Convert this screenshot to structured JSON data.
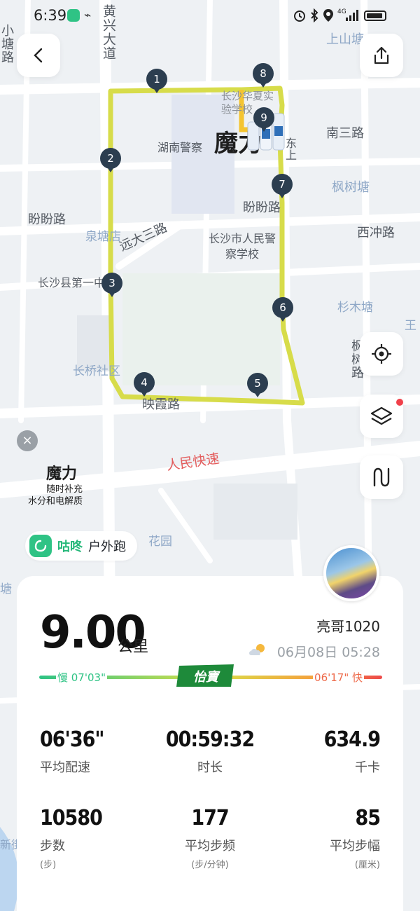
{
  "status_bar": {
    "time": "6:39",
    "network": "4G"
  },
  "map": {
    "labels": {
      "huangxing": "黄兴大道",
      "xiaotang": "小塘路",
      "shangshan": "上山塘",
      "nansan": "南三路",
      "hunan_police": "湖南警察",
      "fengshu": "枫树塘",
      "panpan_left": "盼盼路",
      "panpan_right": "盼盼路",
      "quantang": "泉塘店",
      "yuanda": "远大三路",
      "police_school": "长沙市人民警察学校",
      "xichong": "西冲路",
      "county_school": "长沙县第一中学",
      "shanmu": "杉木塘",
      "wang": "王",
      "fengshu_road": "枫树路",
      "changqiao": "长桥社区",
      "yingxia": "映霞路",
      "renmin": "人民快速",
      "huayuan": "花园",
      "tang": "塘",
      "xinjie": "新街",
      "shiyan": "长沙华夏实验学校",
      "dong": "东上"
    },
    "route_color": "#d7dc4a",
    "km_markers": [
      "1",
      "2",
      "3",
      "4",
      "5",
      "6",
      "7",
      "8",
      "9"
    ]
  },
  "ad": {
    "brand": "魔力",
    "line1": "随时补充",
    "line2": "水分和电解质",
    "close": "×"
  },
  "app": {
    "name": "咕咚",
    "mode": "户外跑",
    "accent": "#2fc385"
  },
  "activity": {
    "distance": "9.00",
    "distance_unit": "公里",
    "username": "亮哥1020",
    "datetime": "06月08日 05:28",
    "pace_slow": "慢 07'03\"",
    "pace_fast": "06'17\" 快",
    "sponsor": "怡寶"
  },
  "stats": {
    "avg_pace": {
      "value": "06'36\"",
      "label": "平均配速"
    },
    "duration": {
      "value": "00:59:32",
      "label": "时长"
    },
    "calories": {
      "value": "634.9",
      "label": "千卡"
    },
    "steps": {
      "value": "10580",
      "label": "步数",
      "unit": "(步)"
    },
    "cadence": {
      "value": "177",
      "label": "平均步频",
      "unit": "(步/分钟)"
    },
    "stride": {
      "value": "85",
      "label": "平均步幅",
      "unit": "(厘米)"
    }
  }
}
